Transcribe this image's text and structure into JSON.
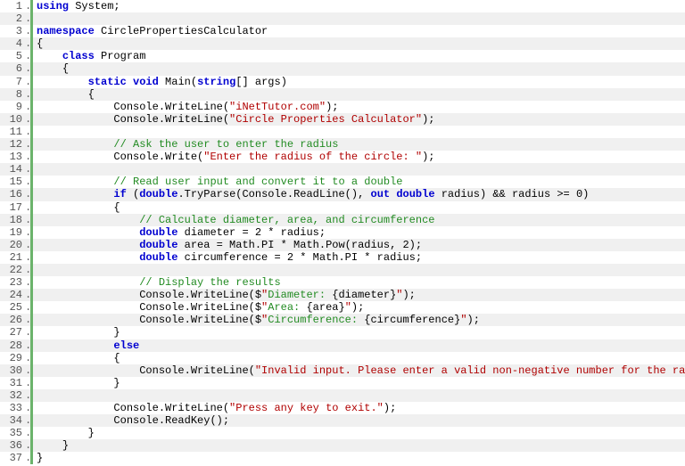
{
  "lines": [
    {
      "n": 1,
      "indent": 0,
      "segs": [
        {
          "c": "kw",
          "t": "using"
        },
        {
          "c": "plain",
          "t": " System;"
        }
      ]
    },
    {
      "n": 2,
      "indent": 0,
      "segs": []
    },
    {
      "n": 3,
      "indent": 0,
      "segs": [
        {
          "c": "kw",
          "t": "namespace"
        },
        {
          "c": "plain",
          "t": " CirclePropertiesCalculator"
        }
      ]
    },
    {
      "n": 4,
      "indent": 0,
      "segs": [
        {
          "c": "plain",
          "t": "{"
        }
      ]
    },
    {
      "n": 5,
      "indent": 4,
      "segs": [
        {
          "c": "kw",
          "t": "class"
        },
        {
          "c": "plain",
          "t": " Program"
        }
      ]
    },
    {
      "n": 6,
      "indent": 4,
      "segs": [
        {
          "c": "plain",
          "t": "{"
        }
      ]
    },
    {
      "n": 7,
      "indent": 8,
      "segs": [
        {
          "c": "kw",
          "t": "static"
        },
        {
          "c": "plain",
          "t": " "
        },
        {
          "c": "kw",
          "t": "void"
        },
        {
          "c": "plain",
          "t": " Main("
        },
        {
          "c": "kw",
          "t": "string"
        },
        {
          "c": "plain",
          "t": "[] args)"
        }
      ]
    },
    {
      "n": 8,
      "indent": 8,
      "segs": [
        {
          "c": "plain",
          "t": "{"
        }
      ]
    },
    {
      "n": 9,
      "indent": 12,
      "segs": [
        {
          "c": "plain",
          "t": "Console.WriteLine("
        },
        {
          "c": "str",
          "t": "\"iNetTutor.com\""
        },
        {
          "c": "plain",
          "t": ");"
        }
      ]
    },
    {
      "n": 10,
      "indent": 12,
      "segs": [
        {
          "c": "plain",
          "t": "Console.WriteLine("
        },
        {
          "c": "str",
          "t": "\"Circle Properties Calculator\""
        },
        {
          "c": "plain",
          "t": ");"
        }
      ]
    },
    {
      "n": 11,
      "indent": 0,
      "segs": []
    },
    {
      "n": 12,
      "indent": 12,
      "segs": [
        {
          "c": "cm",
          "t": "// Ask the user to enter the radius"
        }
      ]
    },
    {
      "n": 13,
      "indent": 12,
      "segs": [
        {
          "c": "plain",
          "t": "Console.Write("
        },
        {
          "c": "str",
          "t": "\"Enter the radius of the circle: \""
        },
        {
          "c": "plain",
          "t": ");"
        }
      ]
    },
    {
      "n": 14,
      "indent": 0,
      "segs": []
    },
    {
      "n": 15,
      "indent": 12,
      "segs": [
        {
          "c": "cm",
          "t": "// Read user input and convert it to a double"
        }
      ]
    },
    {
      "n": 16,
      "indent": 12,
      "segs": [
        {
          "c": "kw",
          "t": "if"
        },
        {
          "c": "plain",
          "t": " ("
        },
        {
          "c": "kw",
          "t": "double"
        },
        {
          "c": "plain",
          "t": ".TryParse(Console.ReadLine(), "
        },
        {
          "c": "kw",
          "t": "out"
        },
        {
          "c": "plain",
          "t": " "
        },
        {
          "c": "kw",
          "t": "double"
        },
        {
          "c": "plain",
          "t": " radius) && radius >= 0)"
        }
      ]
    },
    {
      "n": 17,
      "indent": 12,
      "segs": [
        {
          "c": "plain",
          "t": "{"
        }
      ]
    },
    {
      "n": 18,
      "indent": 16,
      "segs": [
        {
          "c": "cm",
          "t": "// Calculate diameter, area, and circumference"
        }
      ]
    },
    {
      "n": 19,
      "indent": 16,
      "segs": [
        {
          "c": "kw",
          "t": "double"
        },
        {
          "c": "plain",
          "t": " diameter = 2 * radius;"
        }
      ]
    },
    {
      "n": 20,
      "indent": 16,
      "segs": [
        {
          "c": "kw",
          "t": "double"
        },
        {
          "c": "plain",
          "t": " area = Math.PI * Math.Pow(radius, 2);"
        }
      ]
    },
    {
      "n": 21,
      "indent": 16,
      "segs": [
        {
          "c": "kw",
          "t": "double"
        },
        {
          "c": "plain",
          "t": " circumference = 2 * Math.PI * radius;"
        }
      ]
    },
    {
      "n": 22,
      "indent": 0,
      "segs": []
    },
    {
      "n": 23,
      "indent": 16,
      "segs": [
        {
          "c": "cm",
          "t": "// Display the results"
        }
      ]
    },
    {
      "n": 24,
      "indent": 16,
      "segs": [
        {
          "c": "plain",
          "t": "Console.WriteLine($"
        },
        {
          "c": "str",
          "t": "\""
        },
        {
          "c": "ifstr",
          "t": "Diameter: "
        },
        {
          "c": "plain",
          "t": "{diameter}"
        },
        {
          "c": "str",
          "t": "\""
        },
        {
          "c": "plain",
          "t": ");"
        }
      ]
    },
    {
      "n": 25,
      "indent": 16,
      "segs": [
        {
          "c": "plain",
          "t": "Console.WriteLine($"
        },
        {
          "c": "str",
          "t": "\""
        },
        {
          "c": "ifstr",
          "t": "Area: "
        },
        {
          "c": "plain",
          "t": "{area}"
        },
        {
          "c": "str",
          "t": "\""
        },
        {
          "c": "plain",
          "t": ");"
        }
      ]
    },
    {
      "n": 26,
      "indent": 16,
      "segs": [
        {
          "c": "plain",
          "t": "Console.WriteLine($"
        },
        {
          "c": "str",
          "t": "\""
        },
        {
          "c": "ifstr",
          "t": "Circumference: "
        },
        {
          "c": "plain",
          "t": "{circumference}"
        },
        {
          "c": "str",
          "t": "\""
        },
        {
          "c": "plain",
          "t": ");"
        }
      ]
    },
    {
      "n": 27,
      "indent": 12,
      "segs": [
        {
          "c": "plain",
          "t": "}"
        }
      ]
    },
    {
      "n": 28,
      "indent": 12,
      "segs": [
        {
          "c": "kw",
          "t": "else"
        }
      ]
    },
    {
      "n": 29,
      "indent": 12,
      "segs": [
        {
          "c": "plain",
          "t": "{"
        }
      ]
    },
    {
      "n": 30,
      "indent": 16,
      "segs": [
        {
          "c": "plain",
          "t": "Console.WriteLine("
        },
        {
          "c": "str",
          "t": "\"Invalid input. Please enter a valid non-negative number for the radius.\""
        },
        {
          "c": "plain",
          "t": ");"
        }
      ]
    },
    {
      "n": 31,
      "indent": 12,
      "segs": [
        {
          "c": "plain",
          "t": "}"
        }
      ]
    },
    {
      "n": 32,
      "indent": 0,
      "segs": []
    },
    {
      "n": 33,
      "indent": 12,
      "segs": [
        {
          "c": "plain",
          "t": "Console.WriteLine("
        },
        {
          "c": "str",
          "t": "\"Press any key to exit.\""
        },
        {
          "c": "plain",
          "t": ");"
        }
      ]
    },
    {
      "n": 34,
      "indent": 12,
      "segs": [
        {
          "c": "plain",
          "t": "Console.ReadKey();"
        }
      ]
    },
    {
      "n": 35,
      "indent": 8,
      "segs": [
        {
          "c": "plain",
          "t": "}"
        }
      ]
    },
    {
      "n": 36,
      "indent": 4,
      "segs": [
        {
          "c": "plain",
          "t": "}"
        }
      ]
    },
    {
      "n": 37,
      "indent": 0,
      "segs": [
        {
          "c": "plain",
          "t": "}"
        }
      ]
    }
  ]
}
